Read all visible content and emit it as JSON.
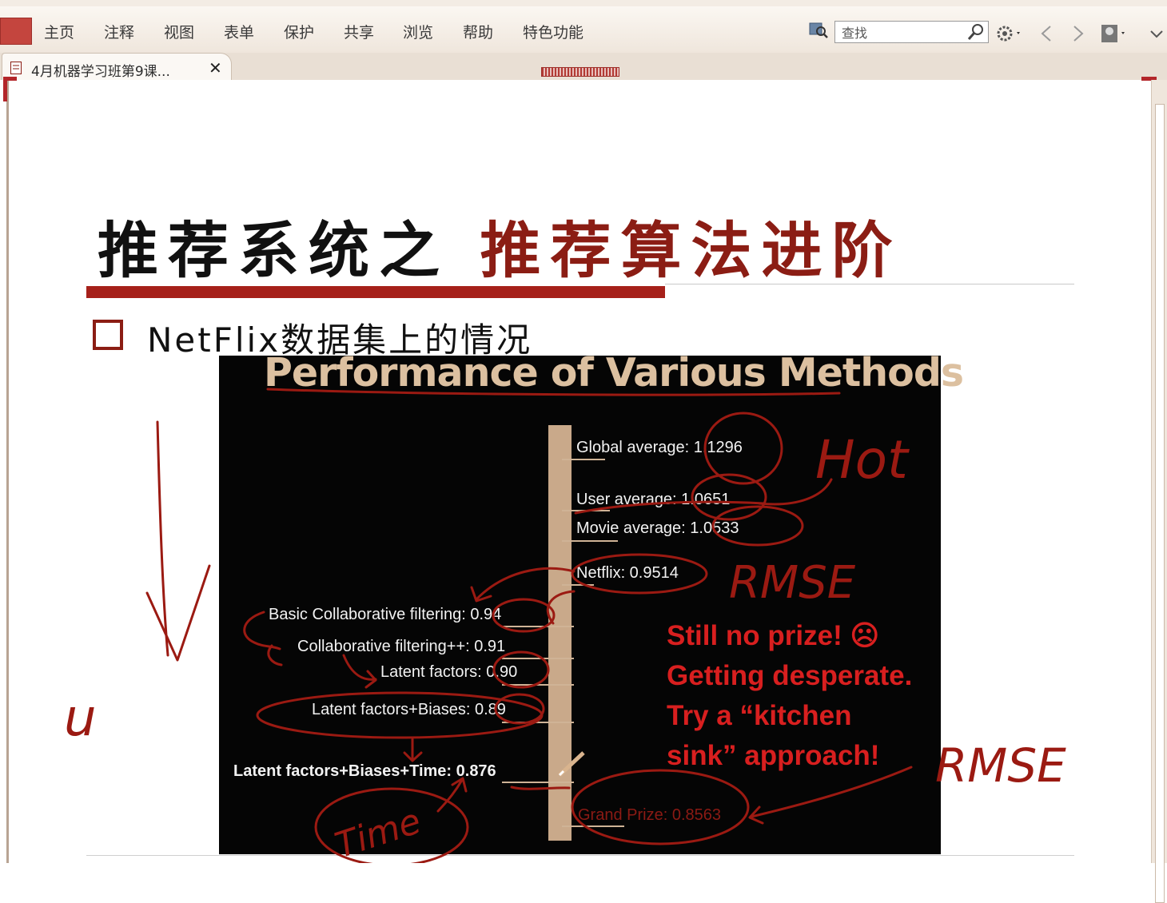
{
  "menubar": {
    "items": [
      "主页",
      "注释",
      "视图",
      "表单",
      "保护",
      "共享",
      "浏览",
      "帮助",
      "特色功能"
    ],
    "search_placeholder": "查找"
  },
  "tab": {
    "label": "4月机器学习班第9课...",
    "close": "✕"
  },
  "slide": {
    "title_black": "推荐系统之",
    "title_red": "推荐算法进阶",
    "bullet": "NetFlix数据集上的情况"
  },
  "figure": {
    "title": "Performance of Various Methods",
    "right_labels": {
      "global": "Global average: 1.1296",
      "user": "User average: 1.0651",
      "movie": "Movie average: 1.0533",
      "netflix": "Netflix: 0.9514",
      "grand": "Grand Prize: 0.8563"
    },
    "left_labels": {
      "basic_cf": "Basic Collaborative filtering: 0.94",
      "cf_pp": "Collaborative filtering++: 0.91",
      "latent": "Latent factors: 0.90",
      "latent_biases": "Latent factors+Biases: 0.89",
      "latent_biases_time": "Latent factors+Biases+Time: 0.876"
    },
    "prize_text": [
      "Still no prize! ☹",
      "Getting desperate.",
      "Try a “kitchen",
      "sink” approach!"
    ]
  },
  "annotations": {
    "hot": "Hot",
    "rmse_1": "RMSE",
    "rmse_2": "RMSE",
    "time": "Time",
    "u": "u"
  },
  "colors": {
    "accent_red": "#a6201a",
    "figure_bg": "#050505",
    "axis": "#c9a98a",
    "ink": "#9b1a12"
  }
}
